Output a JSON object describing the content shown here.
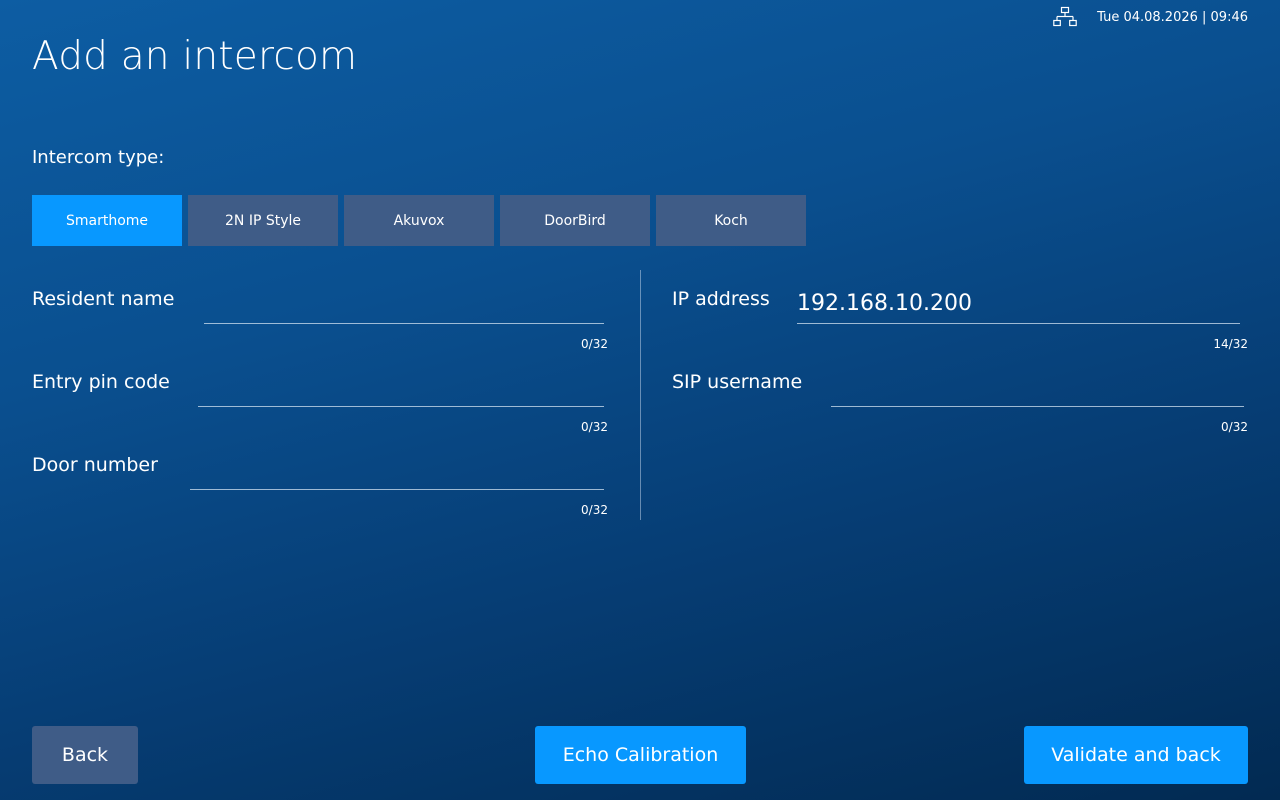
{
  "status_bar": {
    "network_icon": "network-icon",
    "datetime": "Tue 04.08.2026 | 09:46"
  },
  "page": {
    "title": "Add an intercom"
  },
  "intercom_type": {
    "label": "Intercom type:",
    "selected": "Smarthome",
    "options": [
      "Smarthome",
      "2N IP Style",
      "Akuvox",
      "DoorBird",
      "Koch"
    ]
  },
  "form": {
    "resident_name": {
      "label": "Resident name",
      "value": "",
      "counter": "0/32"
    },
    "entry_pin_code": {
      "label": "Entry pin code",
      "value": "",
      "counter": "0/32"
    },
    "door_number": {
      "label": "Door number",
      "value": "",
      "counter": "0/32"
    },
    "ip_address": {
      "label": "IP address",
      "value": "192.168.10.200",
      "counter": "14/32"
    },
    "sip_username": {
      "label": "SIP username",
      "value": "",
      "counter": "0/32"
    }
  },
  "buttons": {
    "back": "Back",
    "echo_calibration": "Echo Calibration",
    "validate_and_back": "Validate and back"
  },
  "colors": {
    "accent": "#0898ff",
    "inactive_button": "#3f5c87",
    "background_top": "#0d5da3",
    "background_bottom": "#022a52"
  }
}
